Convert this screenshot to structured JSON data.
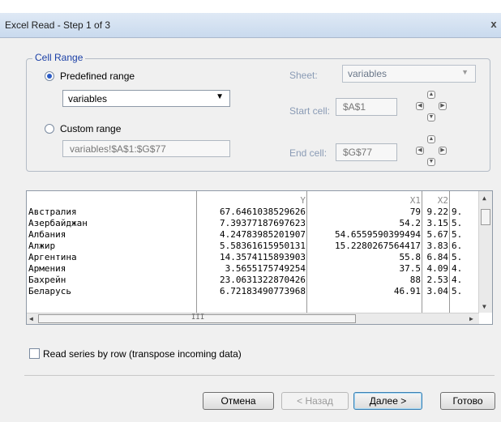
{
  "window": {
    "title": "Excel Read - Step 1 of 3",
    "close_glyph": "x"
  },
  "cell_range": {
    "legend": "Cell Range",
    "predefined_label": "Predefined range",
    "predefined_value": "variables",
    "custom_label": "Custom range",
    "custom_value": "variables!$A$1:$G$77",
    "sheet_label": "Sheet:",
    "sheet_value": "variables",
    "start_label": "Start cell:",
    "start_value": "$A$1",
    "end_label": "End cell:",
    "end_value": "$G$77",
    "selected": "predefined"
  },
  "grid": {
    "headers": [
      "",
      "Y",
      "X1",
      "X2",
      ""
    ],
    "rows": [
      [
        "Австралия",
        "67.6461038529626",
        "79",
        "9.22",
        "9."
      ],
      [
        "Азербайджан",
        "7.39377187697623",
        "54.2",
        "3.15",
        "5."
      ],
      [
        "Албания",
        "4.24783985201907",
        "54.6559590399494",
        "5.67",
        "5."
      ],
      [
        "Алжир",
        "5.58361615950131",
        "15.2280267564417",
        "3.83",
        "6."
      ],
      [
        "Аргентина",
        "14.3574115893903",
        "55.8",
        "6.84",
        "5."
      ],
      [
        "Армения",
        "3.5655175749254",
        "37.5",
        "4.09",
        "4."
      ],
      [
        "Бахрейн",
        "23.0631322870426",
        "88",
        "2.53",
        "4."
      ],
      [
        "Беларусь",
        "6.72183490773968",
        "46.91",
        "3.04",
        "5."
      ]
    ],
    "hscroll_grip": "III"
  },
  "options": {
    "transpose_label": "Read series by row (transpose incoming data)",
    "transpose_checked": false
  },
  "buttons": {
    "cancel": "Отмена",
    "back": "< Назад",
    "next": "Далее >",
    "finish": "Готово"
  }
}
